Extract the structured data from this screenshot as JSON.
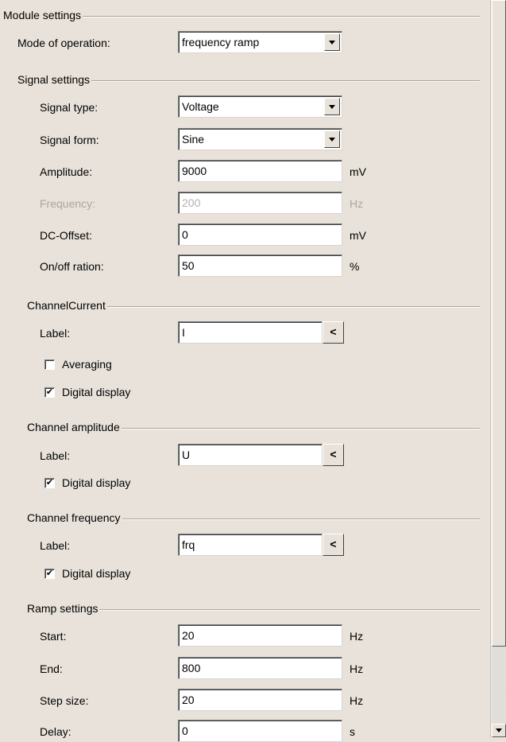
{
  "module": {
    "title": "Module settings",
    "mode_label": "Mode of operation:",
    "mode_value": "frequency ramp"
  },
  "signal": {
    "title": "Signal settings",
    "type_label": "Signal type:",
    "type_value": "Voltage",
    "form_label": "Signal form:",
    "form_value": "Sine",
    "amplitude_label": "Amplitude:",
    "amplitude_value": "9000",
    "amplitude_unit": "mV",
    "frequency_label": "Frequency:",
    "frequency_value": "200",
    "frequency_unit": "Hz",
    "dcoffset_label": "DC-Offset:",
    "dcoffset_value": "0",
    "dcoffset_unit": "mV",
    "onoff_label": "On/off ration:",
    "onoff_value": "50",
    "onoff_unit": "%"
  },
  "channel_current": {
    "title": "ChannelCurrent",
    "label_label": "Label:",
    "label_value": "I",
    "picker": "<",
    "averaging_label": "Averaging",
    "averaging_checked": false,
    "digital_label": "Digital display",
    "digital_checked": true
  },
  "channel_amplitude": {
    "title": "Channel amplitude",
    "label_label": "Label:",
    "label_value": "U",
    "picker": "<",
    "digital_label": "Digital display",
    "digital_checked": true
  },
  "channel_frequency": {
    "title": "Channel frequency",
    "label_label": "Label:",
    "label_value": "frq",
    "picker": "<",
    "digital_label": "Digital display",
    "digital_checked": true
  },
  "ramp": {
    "title": "Ramp settings",
    "start_label": "Start:",
    "start_value": "20",
    "start_unit": "Hz",
    "end_label": "End:",
    "end_value": "800",
    "end_unit": "Hz",
    "step_label": "Step size:",
    "step_value": "20",
    "step_unit": "Hz",
    "delay_label": "Delay:",
    "delay_value": "0",
    "delay_unit": "s"
  },
  "check_glyph": "✔"
}
